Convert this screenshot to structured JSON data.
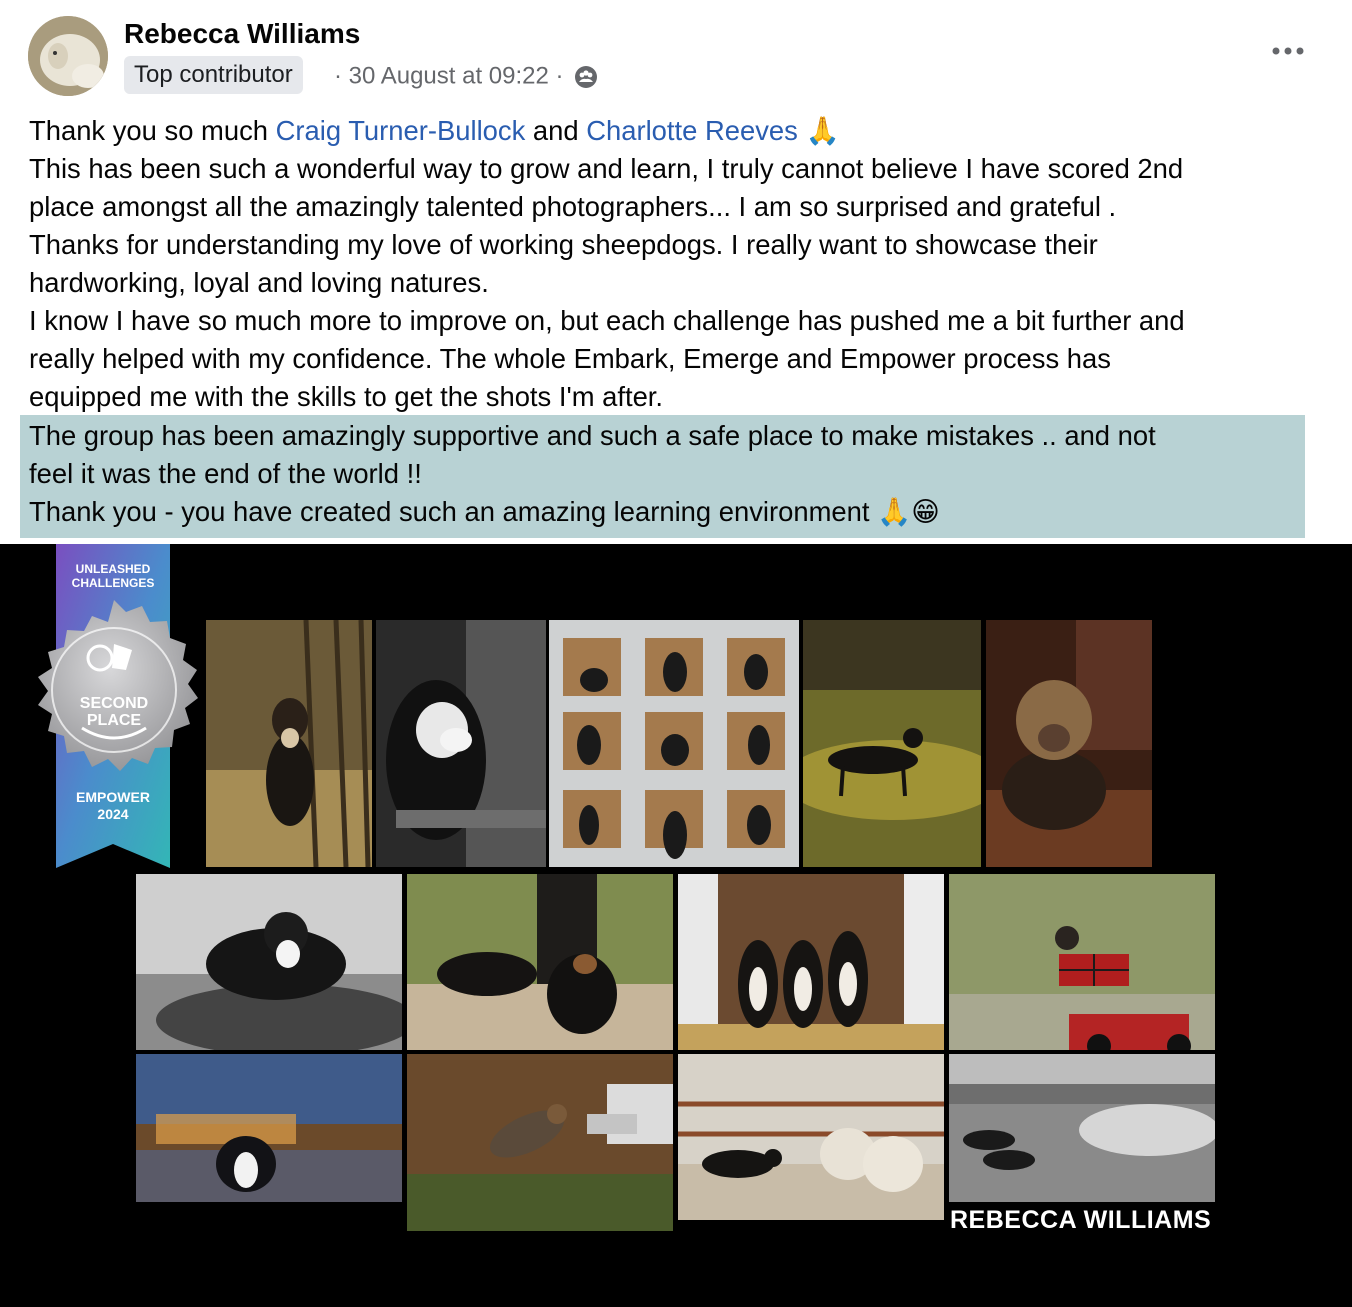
{
  "author": {
    "name": "Rebecca Williams",
    "badge": "Top contributor",
    "timestamp": "30 August at 09:22",
    "separator": "·",
    "privacy_icon": "group-icon"
  },
  "post": {
    "line1_prefix": "Thank you so much ",
    "mention1": "Craig Turner-Bullock",
    "line1_and": " and ",
    "mention2": "Charlotte Reeves",
    "emoji_pray": "🙏",
    "lines": [
      "This has been such a wonderful way to grow and learn, I truly cannot believe I have scored 2nd",
      "place amongst all the amazingly talented photographers... I am so surprised and grateful .",
      "Thanks for understanding my love of working sheepdogs. I really want to showcase their",
      "hardworking, loyal and loving natures.",
      "I know I have so much more to improve on, but each challenge has pushed me a bit further and",
      "really helped with my confidence. The whole Embark, Emerge and Empower process has",
      "equipped me with the skills to get the shots I'm after."
    ],
    "highlighted": [
      "The group has been amazingly supportive and such a safe place to make mistakes .. and not",
      "feel it was the end of the world !!",
      "Thank you - you have created such an amazing learning environment "
    ],
    "emoji_grin": "😁"
  },
  "collage": {
    "ribbon_top": "UNLEASHED",
    "ribbon_top2": "CHALLENGES",
    "medal_line1": "SECOND",
    "medal_line2": "PLACE",
    "ribbon_bottom": "EMPOWER",
    "ribbon_year": "2024",
    "credit": "REBECCA WILLIAMS",
    "colors": {
      "ribbon_top": "#6a5bb8",
      "ribbon_bottom": "#2fb3b8",
      "medal": "#a9a9ab"
    }
  }
}
